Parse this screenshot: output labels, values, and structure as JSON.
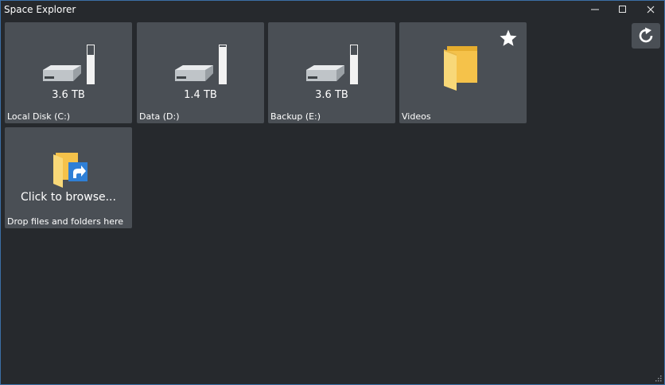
{
  "window": {
    "title": "Space Explorer",
    "minimize_glyph": "—",
    "maximize_glyph": "☐",
    "close_glyph": "✕"
  },
  "toolbar": {
    "refresh_icon": "refresh-icon"
  },
  "drives": [
    {
      "label": "Local Disk (C:)",
      "size": "3.6 TB",
      "used_fraction": 0.76
    },
    {
      "label": "Data (D:)",
      "size": "1.4 TB",
      "used_fraction": 0.96
    },
    {
      "label": "Backup (E:)",
      "size": "3.6 TB",
      "used_fraction": 0.76
    }
  ],
  "favorites": [
    {
      "label": "Videos",
      "starred": true,
      "icon": "folder-icon"
    }
  ],
  "browse_tile": {
    "text": "Click to browse...",
    "label": "Drop files and folders here",
    "icon": "folder-shortcut-icon"
  },
  "colors": {
    "background": "#26292d",
    "tile": "#4a4f55",
    "folder_yellow": "#f5c24a",
    "shortcut_blue": "#2f7fd6"
  }
}
